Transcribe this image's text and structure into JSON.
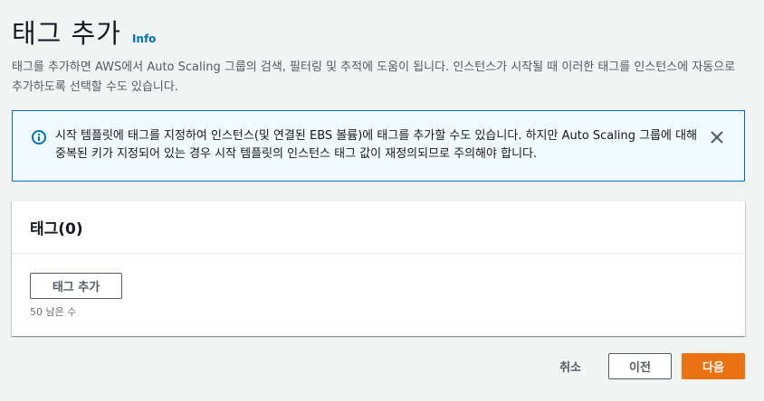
{
  "header": {
    "title": "태그 추가",
    "info_link": "Info"
  },
  "description": "태그를 추가하면 AWS에서 Auto Scaling 그룹의 검색, 필터링 및 추적에 도움이 됩니다. 인스턴스가 시작될 때 이러한 태그를 인스턴스에 자동으로 추가하도록 선택할 수도 있습니다.",
  "alert": {
    "icon": "info-circle-icon",
    "text": "시작 템플릿에 태그를 지정하여 인스턴스(및 연결된 EBS 볼륨)에 태그를 추가할 수도 있습니다. 하지만 Auto Scaling 그룹에 대해 중복된 키가 지정되어 있는 경우 시작 템플릿의 인스턴스 태그 값이 재정의되므로 주의해야 합니다.",
    "close_icon": "close-icon",
    "color": "#0073bb",
    "background": "#f1faff"
  },
  "tags_panel": {
    "title": "태그(0)",
    "add_button": "태그 추가",
    "remaining": "50 남은 수"
  },
  "footer": {
    "cancel": "취소",
    "previous": "이전",
    "next": "다음",
    "primary_color": "#ec7211"
  }
}
